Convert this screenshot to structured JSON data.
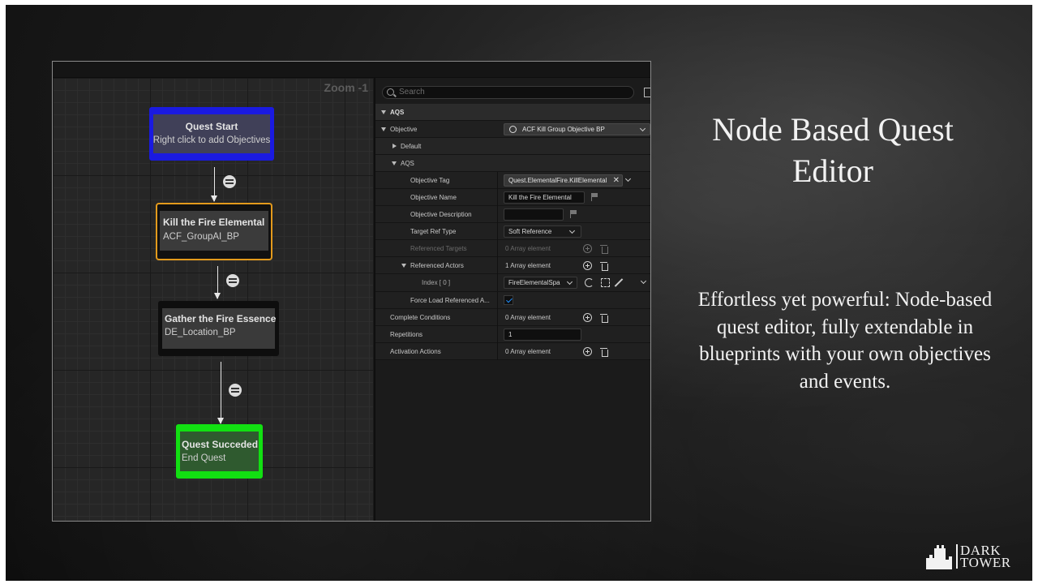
{
  "graph": {
    "zoom_label": "Zoom -1",
    "nodes": [
      {
        "title": "Quest Start",
        "subtitle": "Right click to add Objectives",
        "color": "#1a1ae0"
      },
      {
        "title": "Kill the Fire Elemental",
        "subtitle": "ACF_GroupAI_BP",
        "color": "#e39a1c"
      },
      {
        "title": "Gather the Fire Essence",
        "subtitle": "DE_Location_BP",
        "color": "#0e0e0e"
      },
      {
        "title": "Quest Succeded",
        "subtitle": "End Quest",
        "color": "#12e012"
      }
    ]
  },
  "details": {
    "search_placeholder": "Search",
    "section_aqs": "AQS",
    "objective_label": "Objective",
    "objective_value": "ACF Kill Group Objective BP",
    "default_label": "Default",
    "aqs_sub_label": "AQS",
    "rows": {
      "objective_tag": {
        "label": "Objective Tag",
        "value": "Quest.ElementalFire.KillElemental"
      },
      "objective_name": {
        "label": "Objective Name",
        "value": "Kill the Fire Elemental"
      },
      "objective_description": {
        "label": "Objective Description",
        "value": ""
      },
      "target_ref_type": {
        "label": "Target Ref Type",
        "value": "Soft Reference"
      },
      "referenced_targets": {
        "label": "Referenced Targets",
        "value": "0 Array element"
      },
      "referenced_actors": {
        "label": "Referenced Actors",
        "value": "1 Array element"
      },
      "index0": {
        "label": "Index [ 0 ]",
        "value": "FireElementalSpa"
      },
      "force_load": {
        "label": "Force Load Referenced A...",
        "checked": true
      },
      "complete_conditions": {
        "label": "Complete Conditions",
        "value": "0 Array element"
      },
      "repetitions": {
        "label": "Repetitions",
        "value": "1"
      },
      "activation_actions": {
        "label": "Activation Actions",
        "value": "0 Array element"
      }
    }
  },
  "slide": {
    "heading": "Node Based Quest Editor",
    "body": "Effortless yet powerful: Node-based quest editor, fully extendable in blueprints with your own objectives and events."
  },
  "logo": {
    "line1": "DARK",
    "line2": "TOWER"
  },
  "icons": [
    "search-icon",
    "grid-icon",
    "chevron-down-icon",
    "plus-icon",
    "trash-icon",
    "flag-icon",
    "browse-icon",
    "select-actor-icon",
    "eyedropper-icon",
    "checkmark-icon",
    "close-icon",
    "castle-icon",
    "transition-icon"
  ]
}
